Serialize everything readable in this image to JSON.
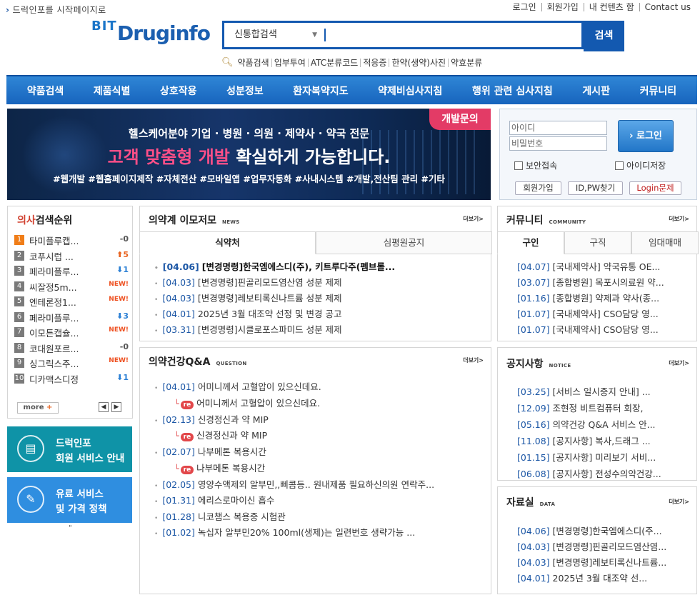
{
  "top": {
    "home_link": "드럭인포를 시작페이지로",
    "util_links": [
      "로그인",
      "회원가입",
      "내 컨텐츠 함",
      "Contact us"
    ]
  },
  "logo": {
    "bit": "BIT",
    "drug": "Druginfo"
  },
  "search": {
    "category": "신통합검색",
    "value": "",
    "button": "검색",
    "quick_links": [
      "약품검색",
      "입부투여",
      "ATC분류코드",
      "적응증",
      "한약(생약)사진",
      "약효분류"
    ]
  },
  "gnb": [
    "약품검색",
    "제품식별",
    "상호작용",
    "성분정보",
    "환자복약지도",
    "약제비심사지침",
    "행위 관련 심사지침",
    "게시판",
    "커뮤니티"
  ],
  "banner": {
    "tag": "개발문의",
    "line1": "헬스케어분야 기업 · 병원 · 의원 · 제약사 · 약국 전문",
    "line2_highlight": "고객 맞춤형 개발",
    "line2_rest": " 확실하게 가능합니다.",
    "line3": "#웹개발  #웹홈페이지제작  #자체전산  #모바일앱  #업무자동화  #사내시스템  #개발,전산팀 관리  #기타"
  },
  "login": {
    "id_placeholder": "아이디",
    "pw_placeholder": "비밀번호",
    "button": "로그인",
    "secure": "보안접속",
    "save_id": "아이디저장",
    "links": [
      "회원가입",
      "ID,PW찾기",
      "Login문제"
    ]
  },
  "rank": {
    "title_red": "의사",
    "title_rest": "검색순위",
    "items": [
      {
        "no": "1",
        "name": "타미플루캡...",
        "change": "-0",
        "dir": "same"
      },
      {
        "no": "2",
        "name": "코푸시럽 ...",
        "change": "5",
        "dir": "up"
      },
      {
        "no": "3",
        "name": "페라미플루...",
        "change": "1",
        "dir": "down"
      },
      {
        "no": "4",
        "name": "씨잘정5m...",
        "change": "NEW!",
        "dir": "new"
      },
      {
        "no": "5",
        "name": "엔테론정1...",
        "change": "NEW!",
        "dir": "new"
      },
      {
        "no": "6",
        "name": "페라미플루...",
        "change": "3",
        "dir": "down"
      },
      {
        "no": "7",
        "name": "이모튼캡슐...",
        "change": "NEW!",
        "dir": "new"
      },
      {
        "no": "8",
        "name": "코대원포르...",
        "change": "-0",
        "dir": "same"
      },
      {
        "no": "9",
        "name": "싱그릭스주...",
        "change": "NEW!",
        "dir": "new"
      },
      {
        "no": "10",
        "name": "디카맥스디정",
        "change": "1",
        "dir": "down"
      }
    ],
    "more": "more",
    "plus": "+"
  },
  "side_buttons": [
    {
      "line1": "드럭인포",
      "line2": "회원 서비스 안내"
    },
    {
      "line1": "유료 서비스",
      "line2": "및 가격 정책"
    }
  ],
  "side_quote": "\"",
  "news": {
    "title": "의약계 이모저모",
    "tag": "NEWS",
    "more": "더보기>",
    "tabs": [
      "식약처",
      "심평원공지"
    ],
    "items": [
      {
        "date": "[04.06]",
        "text": "[변경명령]한국엠에스디(주), 키트루다주(펨브롤..."
      },
      {
        "date": "[04.03]",
        "text": "[변경명령]핀골리모드염산염 성분 제제"
      },
      {
        "date": "[04.03]",
        "text": "[변경명령]레보티록신나트륨 성분 제제"
      },
      {
        "date": "[04.01]",
        "text": "2025년 3월 대조약 선정 및 변경 공고"
      },
      {
        "date": "[03.31]",
        "text": "[변경명령]시클로포스파미드 성분 제제"
      }
    ]
  },
  "qa": {
    "title": "의약건강Q&A",
    "tag": "QUESTION",
    "more": "더보기>",
    "re_label": "re",
    "items": [
      {
        "date": "[04.01]",
        "text": "어미니께서 고혈압이 있으신데요.",
        "reply": "어미니께서 고혈압이 있으신데요."
      },
      {
        "date": "[02.13]",
        "text": "신경정신과 약 MIP",
        "reply": "신경정신과 약 MIP"
      },
      {
        "date": "[02.07]",
        "text": "나부메톤 복용시간",
        "reply": "나부메톤 복용시간"
      },
      {
        "date": "[02.05]",
        "text": "영양수액제외 알부민,,삐콤등.. 원내제품 필요하신의원 연락주...",
        "reply": ""
      },
      {
        "date": "[01.31]",
        "text": "에리스로마이신 흡수",
        "reply": ""
      },
      {
        "date": "[01.28]",
        "text": "니코챔스 복용중 시험관",
        "reply": ""
      },
      {
        "date": "[01.02]",
        "text": "녹십자 알부민20% 100ml(생제)는 일련번호 생략가능 ...",
        "reply": ""
      }
    ]
  },
  "community": {
    "title": "커뮤니티",
    "tag": "COMMUNITY",
    "more": "더보기>",
    "tabs": [
      "구인",
      "구직",
      "임대매매"
    ],
    "items": [
      {
        "date": "[04.07]",
        "text": "[국내제약사] 약국유통 OE..."
      },
      {
        "date": "[03.07]",
        "text": "[종합병원] 목포시의료원 약..."
      },
      {
        "date": "[01.16]",
        "text": "[종합병원] 약제과 약사(종..."
      },
      {
        "date": "[01.07]",
        "text": "[국내제약사] CSO담당 영..."
      },
      {
        "date": "[01.07]",
        "text": "[국내제약사] CSO담당 영..."
      }
    ]
  },
  "notice": {
    "title": "공지사항",
    "tag": "NOTICE",
    "more": "더보기>",
    "items": [
      {
        "date": "[03.25]",
        "text": "[서비스 일시중지 안내] ..."
      },
      {
        "date": "[12.09]",
        "text": "조현정 비트컴퓨터 회장, "
      },
      {
        "date": "[05.16]",
        "text": "의약건강 Q&A 서비스 안..."
      },
      {
        "date": "[11.08]",
        "text": "[공지사항] 복사,드래그 ..."
      },
      {
        "date": "[01.15]",
        "text": "[공지사항] 미리보기 서비..."
      },
      {
        "date": "[06.08]",
        "text": "[공지사항] 전성수의약건강..."
      }
    ]
  },
  "data_board": {
    "title": "자료실",
    "tag": "DATA",
    "more": "더보기>",
    "items": [
      {
        "date": "[04.06]",
        "text": "[변경명령]한국엠에스디(주..."
      },
      {
        "date": "[04.03]",
        "text": "[변경명령]핀골리모드염산염..."
      },
      {
        "date": "[04.03]",
        "text": "[변경명령]레보티록신나트륨..."
      },
      {
        "date": "[04.01]",
        "text": "2025년 3월 대조약 선..."
      }
    ]
  },
  "colors": {
    "brand": "#1359b0",
    "accent": "#e33b66",
    "gnb": "#1764bd"
  }
}
